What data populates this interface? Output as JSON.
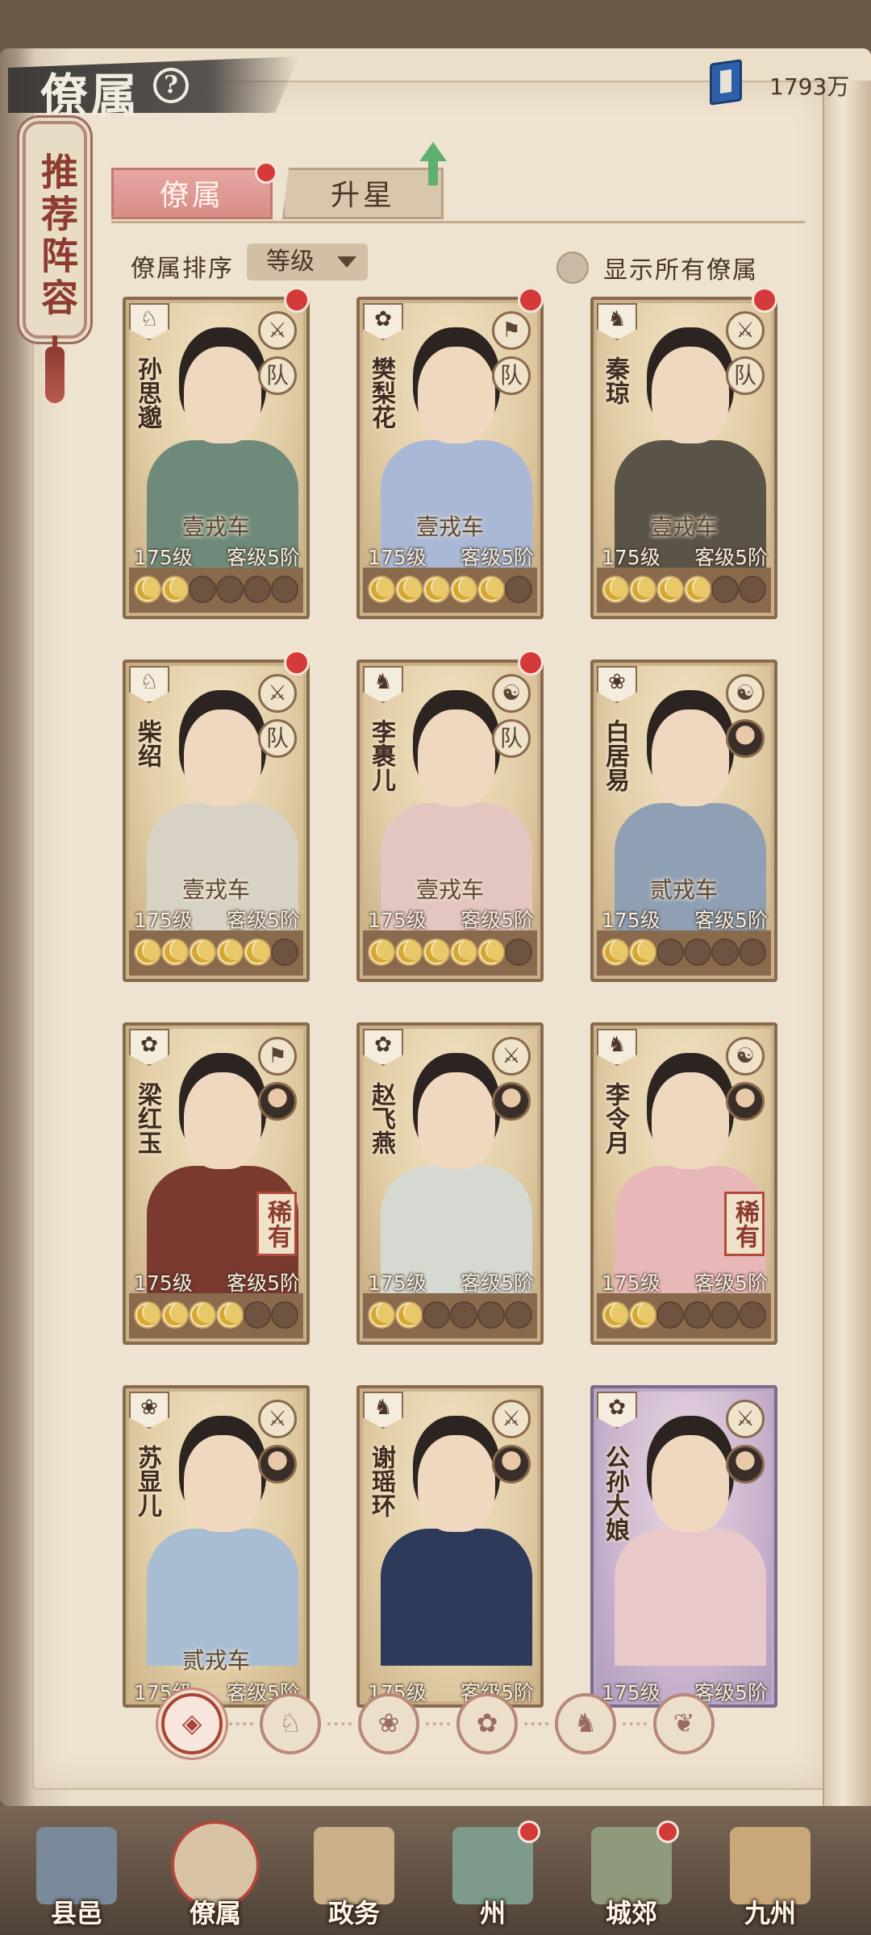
{
  "header": {
    "title": "僚属",
    "help_icon": "help-icon",
    "currency_icon": "book-icon",
    "currency_value": "1793万"
  },
  "recommend": {
    "label": "推荐阵容"
  },
  "tabs": [
    {
      "label": "僚属",
      "active": true
    },
    {
      "label": "升星",
      "active": false
    }
  ],
  "sort": {
    "label": "僚属排序",
    "selected": "等级"
  },
  "show_all": {
    "label": "显示所有僚属",
    "checked": false
  },
  "cards": [
    {
      "name": "孙思邈",
      "vehicle": "壹戎车",
      "level": "175级",
      "rank": "客级5阶",
      "role": "队",
      "stars_on": 2,
      "rare": "",
      "red_dot": true,
      "purple": false
    },
    {
      "name": "樊梨花",
      "vehicle": "壹戎车",
      "level": "175级",
      "rank": "客级5阶",
      "role": "队",
      "stars_on": 5,
      "rare": "",
      "red_dot": true,
      "purple": false
    },
    {
      "name": "秦琼",
      "vehicle": "壹戎车",
      "level": "175级",
      "rank": "客级5阶",
      "role": "队",
      "stars_on": 4,
      "rare": "",
      "red_dot": true,
      "purple": false
    },
    {
      "name": "柴绍",
      "vehicle": "壹戎车",
      "level": "175级",
      "rank": "客级5阶",
      "role": "队",
      "stars_on": 5,
      "rare": "",
      "red_dot": true,
      "purple": false
    },
    {
      "name": "李裹儿",
      "vehicle": "壹戎车",
      "level": "175级",
      "rank": "客级5阶",
      "role": "队",
      "stars_on": 5,
      "rare": "",
      "red_dot": true,
      "purple": false
    },
    {
      "name": "白居易",
      "vehicle": "贰戎车",
      "level": "175级",
      "rank": "客级5阶",
      "role": "",
      "stars_on": 2,
      "rare": "",
      "red_dot": false,
      "purple": false
    },
    {
      "name": "梁红玉",
      "vehicle": "",
      "level": "175级",
      "rank": "客级5阶",
      "role": "",
      "stars_on": 4,
      "rare": "稀有",
      "red_dot": false,
      "purple": false
    },
    {
      "name": "赵飞燕",
      "vehicle": "",
      "level": "175级",
      "rank": "客级5阶",
      "role": "",
      "stars_on": 2,
      "rare": "",
      "red_dot": false,
      "purple": false
    },
    {
      "name": "李令月",
      "vehicle": "",
      "level": "175级",
      "rank": "客级5阶",
      "role": "",
      "stars_on": 2,
      "rare": "稀有",
      "red_dot": false,
      "purple": false
    },
    {
      "name": "苏显儿",
      "vehicle": "贰戎车",
      "level": "175级",
      "rank": "客级5阶",
      "role": "",
      "stars_on": 0,
      "rare": "",
      "red_dot": false,
      "purple": false
    },
    {
      "name": "谢瑶环",
      "vehicle": "",
      "level": "175级",
      "rank": "客级5阶",
      "role": "",
      "stars_on": 0,
      "rare": "",
      "red_dot": false,
      "purple": false
    },
    {
      "name": "公孙大娘",
      "vehicle": "",
      "level": "175级",
      "rank": "客级5阶",
      "role": "",
      "stars_on": 0,
      "rare": "",
      "red_dot": false,
      "purple": true
    }
  ],
  "filters": [
    {
      "icon": "all-icon",
      "glyph": "◈",
      "active": true
    },
    {
      "icon": "horse-icon",
      "glyph": "♘",
      "active": false
    },
    {
      "icon": "cat-icon",
      "glyph": "❀",
      "active": false
    },
    {
      "icon": "fan-icon",
      "glyph": "✿",
      "active": false
    },
    {
      "icon": "lion-icon",
      "glyph": "♞",
      "active": false
    },
    {
      "icon": "leaf-icon",
      "glyph": "❦",
      "active": false
    }
  ],
  "nav": [
    {
      "label": "县邑",
      "active": false,
      "red_dot": false,
      "color": "#7a8a9a"
    },
    {
      "label": "僚属",
      "active": true,
      "red_dot": false,
      "color": "#d8c3a6"
    },
    {
      "label": "政务",
      "active": false,
      "red_dot": false,
      "color": "#c9b089"
    },
    {
      "label": "州",
      "active": false,
      "red_dot": true,
      "color": "#7d9a8a"
    },
    {
      "label": "城郊",
      "active": false,
      "red_dot": true,
      "color": "#8f9a7a"
    },
    {
      "label": "九州",
      "active": false,
      "red_dot": false,
      "color": "#c8a878"
    }
  ],
  "colors": {
    "accent_red": "#d53a3a",
    "tab_active": "#d88d88",
    "paper": "#eee3d0"
  }
}
